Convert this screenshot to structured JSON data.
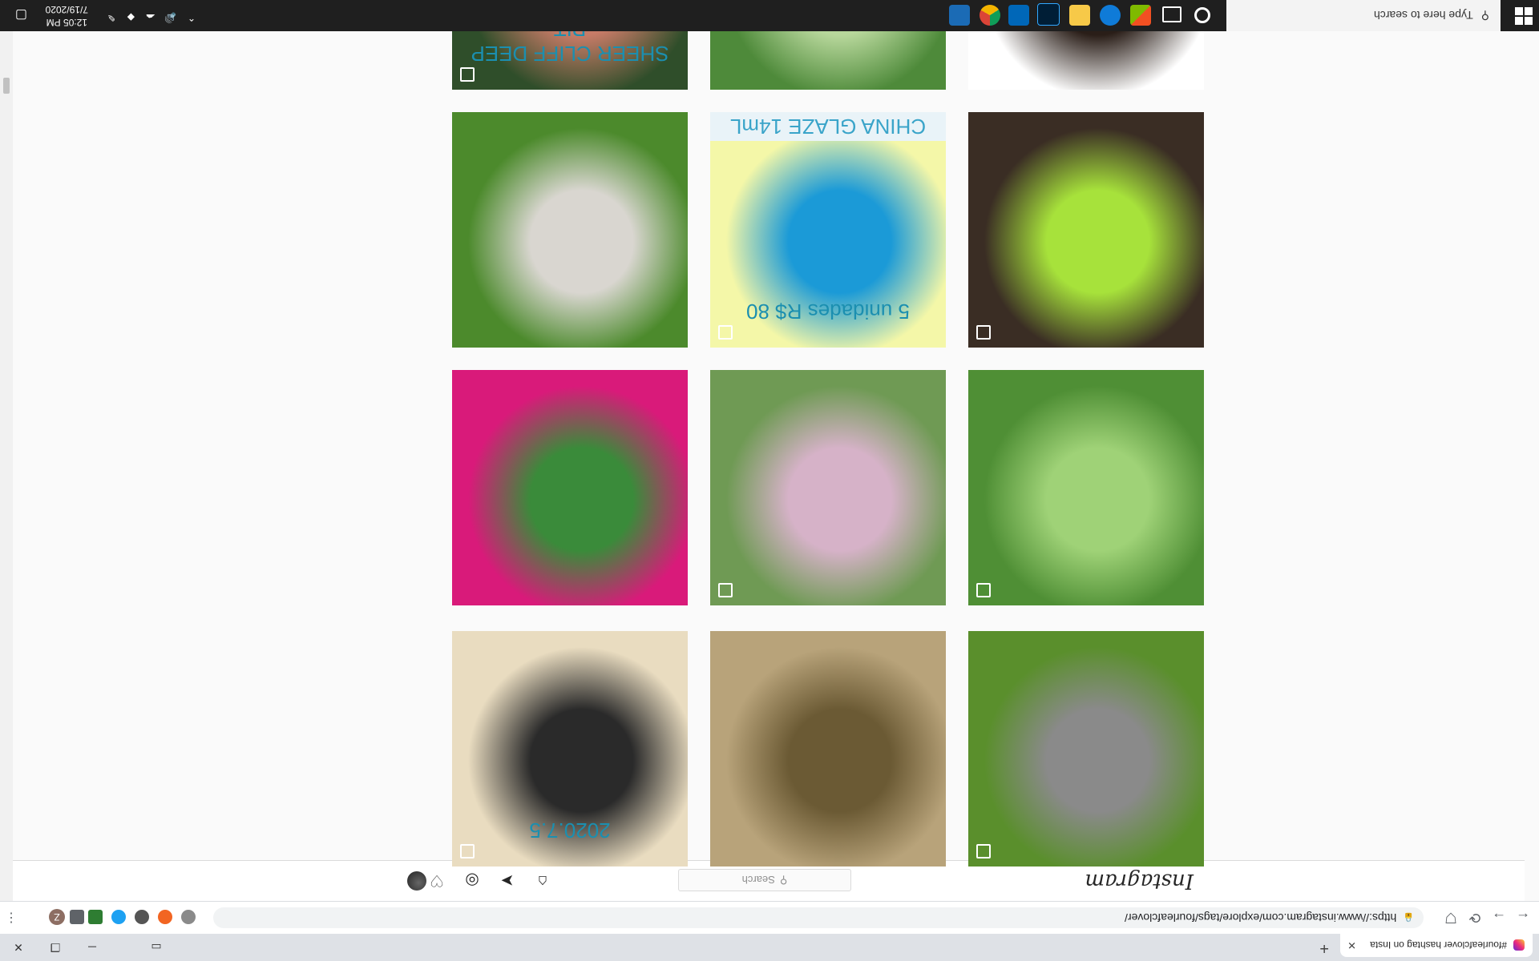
{
  "browser": {
    "tab_title": "#fourleafclover hashtag on Insta",
    "new_tab": "+",
    "url": "https://www.instagram.com/explore/tags/fourleafclover/",
    "profile_initial": "Z"
  },
  "instagram": {
    "logo": "Instagram",
    "search_placeholder": "Search"
  },
  "taskbar": {
    "search_placeholder": "Type here to search",
    "time": "12:05 PM",
    "date": "7/19/2020"
  },
  "photos": [
    {
      "desc": "clover-leaf-on-pavement",
      "colors": [
        "#5a8f2c",
        "#8a8a8a"
      ],
      "icon": "gallery-icon"
    },
    {
      "desc": "selfie-with-clover",
      "colors": [
        "#b8a37a",
        "#6b5a34"
      ],
      "icon": null
    },
    {
      "desc": "calendar-drawing",
      "colors": [
        "#e9dcc0",
        "#2a2a2a"
      ],
      "icon": "gallery-icon",
      "text": "2020.7.5"
    },
    {
      "desc": "clover-patch-with-flowers",
      "colors": [
        "#4f8f35",
        "#9fd277"
      ],
      "icon": "gallery-icon"
    },
    {
      "desc": "hand-holding-clover",
      "colors": [
        "#6f9a54",
        "#d6b2c8"
      ],
      "icon": "video-icon"
    },
    {
      "desc": "clover-on-magenta-flowers",
      "colors": [
        "#d91a7a",
        "#3a8b3a"
      ],
      "icon": null
    },
    {
      "desc": "two-clovers-on-soil",
      "colors": [
        "#3a2d24",
        "#a7e23b"
      ],
      "icon": "gallery-icon"
    },
    {
      "desc": "nail-polish-bottles",
      "colors": [
        "#f4f7a8",
        "#1b9ad7"
      ],
      "icon": "gallery-icon",
      "text": "5 unidades R$ 80",
      "text2": "CHINA GLAZE 14mL"
    },
    {
      "desc": "dog-in-grass",
      "colors": [
        "#4c8a2c",
        "#d9d6d0"
      ],
      "icon": null
    },
    {
      "desc": "hair-bun-with-clover",
      "colors": [
        "#ffffff",
        "#2a1e18"
      ],
      "icon": "gallery-icon"
    },
    {
      "desc": "clover-closeup",
      "colors": [
        "#4e8a3a",
        "#b7d79b"
      ],
      "icon": null
    },
    {
      "desc": "forest-path-with-sign",
      "colors": [
        "#2f4e2a",
        "#c77b67"
      ],
      "icon": "gallery-icon",
      "text": "SHEER CLIFF DEEP PIT"
    }
  ]
}
